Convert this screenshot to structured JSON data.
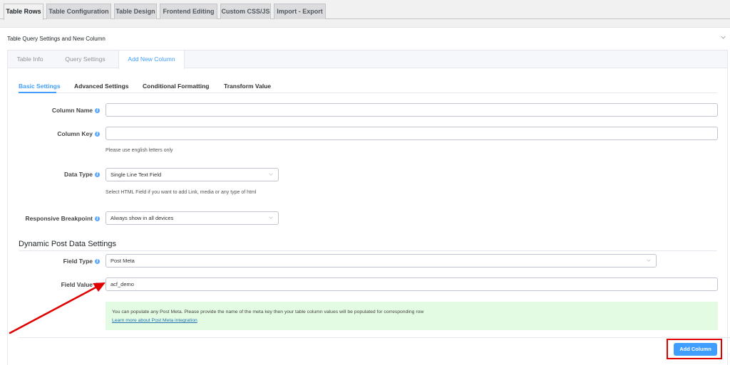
{
  "top_tabs": [
    {
      "label": "Table Rows",
      "active": true
    },
    {
      "label": "Table Configuration",
      "active": false
    },
    {
      "label": "Table Design",
      "active": false
    },
    {
      "label": "Frontend Editing",
      "active": false
    },
    {
      "label": "Custom CSS/JS",
      "active": false
    },
    {
      "label": "Import - Export",
      "active": false
    }
  ],
  "panel": {
    "title": "Table Query Settings and New Column",
    "collapse_icon": "chevron-down-icon"
  },
  "inner_tabs": [
    {
      "label": "Table Info",
      "active": false
    },
    {
      "label": "Query Settings",
      "active": false
    },
    {
      "label": "Add New Column",
      "active": true
    }
  ],
  "sub_tabs": [
    {
      "label": "Basic Settings",
      "active": true
    },
    {
      "label": "Advanced Settings",
      "active": false
    },
    {
      "label": "Conditional Formatting",
      "active": false
    },
    {
      "label": "Transform Value",
      "active": false
    }
  ],
  "form": {
    "column_name": {
      "label": "Column Name",
      "value": ""
    },
    "column_key": {
      "label": "Column Key",
      "value": "",
      "help": "Please use english letters only"
    },
    "data_type": {
      "label": "Data Type",
      "value": "Single Line Text Field",
      "help": "Select HTML Field if you want to add Link, media or any type of html"
    },
    "responsive_breakpoint": {
      "label": "Responsive Breakpoint",
      "value": "Always show in all devices"
    }
  },
  "dynamic_section": {
    "title": "Dynamic Post Data Settings",
    "field_type": {
      "label": "Field Type",
      "value": "Post Meta"
    },
    "field_value": {
      "label": "Field Value",
      "value": "acf_demo"
    },
    "notice": {
      "text": "You can populate any Post Meta. Please provide the name of the meta key then your table column values will be populated for corresponding row",
      "link": "Learn more about Post Meta integration",
      "background": "#e3fbe3"
    }
  },
  "actions": {
    "add_column_label": "Add Column",
    "accent_color": "#409eff"
  },
  "annotations": {
    "highlight_color": "#e00000"
  }
}
